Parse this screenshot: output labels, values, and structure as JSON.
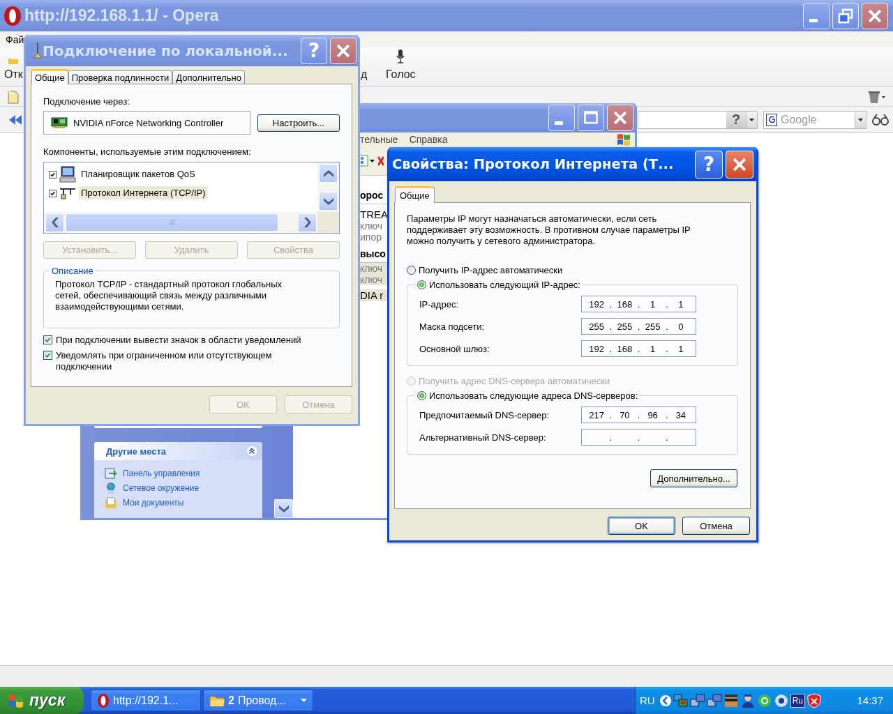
{
  "browser": {
    "title": "http://192.168.1.1/ - Opera",
    "active": false,
    "menu": [
      "Фай"
    ],
    "toolbar": [
      {
        "label": "Отк",
        "kind": "open"
      },
      {
        "label": "д",
        "kind": "plain"
      },
      {
        "label": "Голос",
        "kind": "voice"
      }
    ],
    "help_button": "?",
    "search_placeholder": "Google"
  },
  "explorer": {
    "active": false,
    "menu": [
      "тельные",
      "Справка"
    ],
    "content": [
      {
        "text": "орос",
        "kind": "heading",
        "selected": false
      },
      {
        "text": "TREA",
        "kind": "title",
        "selected": false
      },
      {
        "text": "ключ",
        "kind": "detail",
        "selected": false
      },
      {
        "text": "ипор",
        "kind": "detail",
        "selected": false
      },
      {
        "text": "высо",
        "kind": "heading",
        "selected": false
      },
      {
        "text": "ключ",
        "kind": "detail",
        "selected": true
      },
      {
        "text": "ключ",
        "kind": "detail",
        "selected": true
      },
      {
        "text": "DIA r",
        "kind": "title",
        "selected": true
      }
    ],
    "other_places": {
      "title": "Другие места",
      "links": [
        {
          "label": "Панель управления",
          "kind": "control"
        },
        {
          "label": "Сетевое окружение",
          "kind": "network"
        },
        {
          "label": "Мои документы",
          "kind": "documents"
        }
      ]
    }
  },
  "lan_dialog": {
    "title": "Подключение по локальной...",
    "active": false,
    "help": "?",
    "tabs": [
      {
        "label": "Общие",
        "selected": true
      },
      {
        "label": "Проверка подлинности",
        "selected": false
      },
      {
        "label": "Дополнительно",
        "selected": false
      }
    ],
    "connect_via_label": "Подключение через:",
    "adapter": "NVIDIA nForce Networking Controller",
    "configure_button": "Настроить...",
    "components_label": "Компоненты, используемые этим подключением:",
    "components": [
      {
        "name": "Планировщик пакетов QoS",
        "kind": "scheduler",
        "checked": true,
        "selected": false
      },
      {
        "name": "Протокол Интернета (TCP/IP)",
        "kind": "protocol",
        "checked": true,
        "selected": true
      }
    ],
    "actions": [
      {
        "label": "Установить...",
        "disabled": true
      },
      {
        "label": "Удалить",
        "disabled": true
      },
      {
        "label": "Свойства",
        "disabled": true
      }
    ],
    "description": {
      "title": "Описание",
      "text": "Протокол TCP/IP - стандартный протокол глобальных сетей, обеспечивающий связь между различными взаимодействующими сетями."
    },
    "options": [
      {
        "label": "При подключении вывести значок в области уведомлений",
        "checked": true
      },
      {
        "label": "Уведомлять при ограниченном или отсутствующем подключении",
        "checked": true
      }
    ],
    "buttons": [
      {
        "label": "OK",
        "disabled": true
      },
      {
        "label": "Отмена",
        "disabled": true
      }
    ]
  },
  "tcp_dialog": {
    "title": "Свойства: Протокол Интернета (Т...",
    "active": true,
    "help": "?",
    "tabs": [
      {
        "label": "Общие",
        "selected": true
      }
    ],
    "intro": "Параметры IP могут назначаться автоматически, если сеть поддерживает эту возможность. В противном случае параметры IP можно получить у сетевого администратора.",
    "ip_mode": [
      {
        "label": "Получить IP-адрес автоматически",
        "selected": false,
        "disabled": false
      },
      {
        "label": "Использовать следующий IP-адрес:",
        "selected": true,
        "disabled": false
      }
    ],
    "ip_fields": [
      {
        "label": "IP-адрес:",
        "octets": [
          "192",
          "168",
          "1",
          "1"
        ],
        "separators": [
          ".",
          ".",
          "."
        ]
      },
      {
        "label": "Маска подсети:",
        "octets": [
          "255",
          "255",
          "255",
          "0"
        ],
        "separators": [
          ".",
          ".",
          "."
        ]
      },
      {
        "label": "Основной шлюз:",
        "octets": [
          "192",
          "168",
          "1",
          "1"
        ],
        "separators": [
          ".",
          ".",
          "."
        ]
      }
    ],
    "dns_mode": [
      {
        "label": "Получить адрес DNS-сервера автоматически",
        "selected": false,
        "disabled": true
      },
      {
        "label": "Использовать следующие адреса DNS-серверов:",
        "selected": true,
        "disabled": false
      }
    ],
    "dns_fields": [
      {
        "label": "Предпочитаемый DNS-сервер:",
        "octets": [
          "217",
          "70",
          "96",
          "34"
        ],
        "separators": [
          ".",
          ".",
          "."
        ]
      },
      {
        "label": "Альтернативный DNS-сервер:",
        "separators": [
          ".",
          ".",
          "."
        ]
      }
    ],
    "advanced_button": "Дополнительно...",
    "buttons": [
      {
        "label": "OK",
        "default": true
      },
      {
        "label": "Отмена",
        "default": false
      }
    ]
  },
  "taskbar": {
    "start": "пуск",
    "tasks": [
      {
        "label": "http://192.1...",
        "kind": "browser",
        "selected": false
      },
      {
        "label": "Провод...",
        "count": "2",
        "kind": "folder",
        "selected": false
      }
    ],
    "language": "RU",
    "tray_badge": "Ru",
    "clock": "14:37"
  }
}
